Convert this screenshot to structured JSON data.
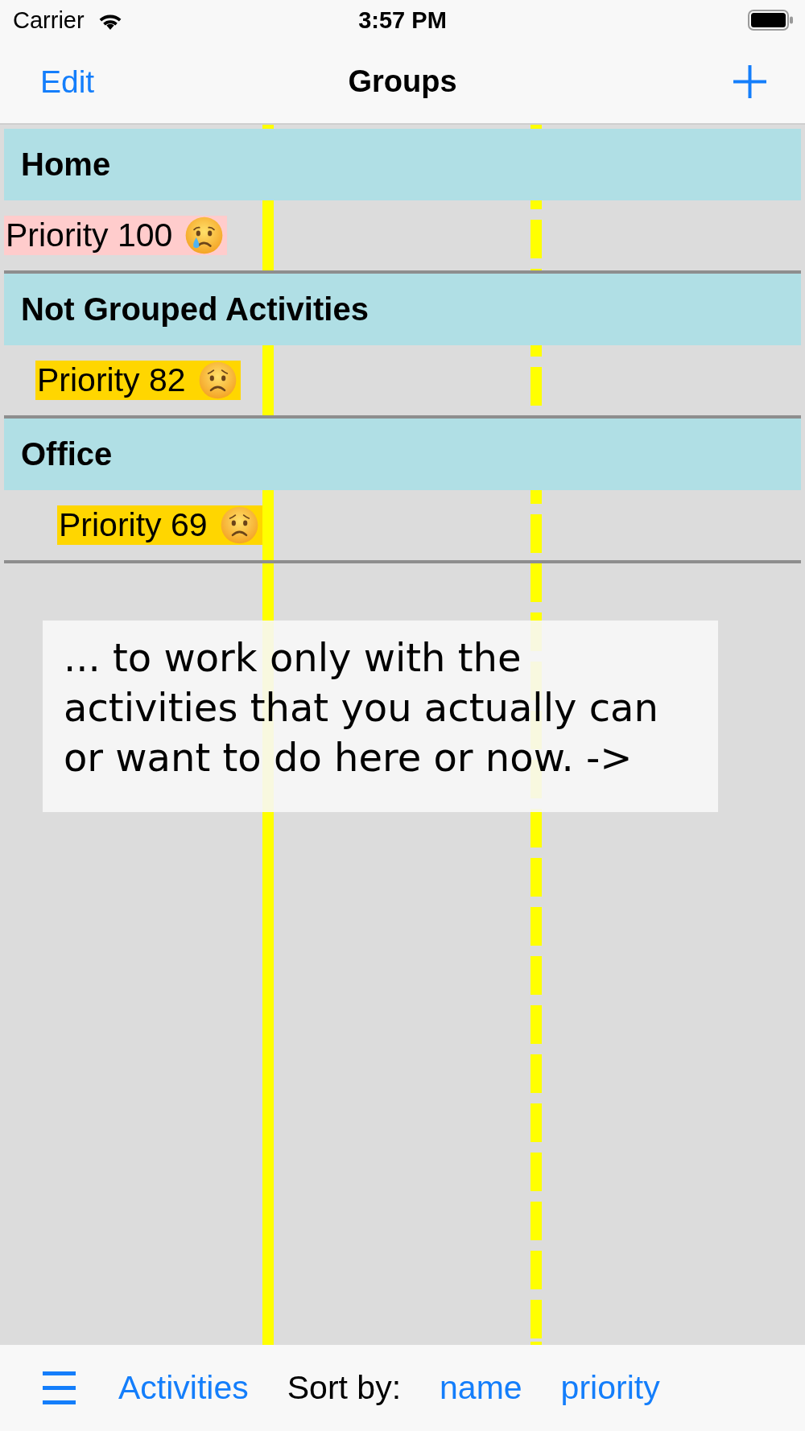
{
  "status_bar": {
    "carrier": "Carrier",
    "time": "3:57 PM"
  },
  "nav_bar": {
    "left_button": "Edit",
    "title": "Groups"
  },
  "sections": [
    {
      "title": "Home",
      "rows": [
        {
          "label": "Priority 100",
          "kind": "crying",
          "color": "#ffcccc"
        }
      ]
    },
    {
      "title": "Not Grouped Activities",
      "rows": [
        {
          "label": "Priority 82",
          "kind": "worried",
          "color": "#ffd600"
        }
      ]
    },
    {
      "title": "Office",
      "rows": [
        {
          "label": "Priority 69",
          "kind": "worried",
          "color": "#ffd600"
        }
      ]
    }
  ],
  "overlay_note": "... to work only with the activities that you actually can or want to do here or now. ->",
  "toolbar": {
    "items": [
      {
        "kind": "link",
        "label": "Activities"
      },
      {
        "kind": "label",
        "label": "Sort by:"
      },
      {
        "kind": "link",
        "label": "name"
      },
      {
        "kind": "link",
        "label": "priority"
      }
    ]
  }
}
